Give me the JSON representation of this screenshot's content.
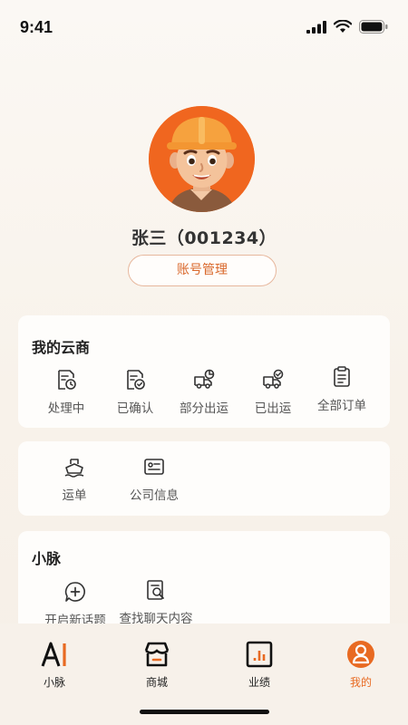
{
  "status_bar": {
    "time": "9:41"
  },
  "profile": {
    "name": "张三（001234）",
    "account_button": "账号管理"
  },
  "yunshang": {
    "title": "我的云商",
    "items": [
      {
        "label": "处理中",
        "icon": "doc-clock-icon"
      },
      {
        "label": "已确认",
        "icon": "doc-check-icon"
      },
      {
        "label": "部分出运",
        "icon": "truck-partial-icon"
      },
      {
        "label": "已出运",
        "icon": "truck-check-icon"
      },
      {
        "label": "全部订单",
        "icon": "clipboard-list-icon"
      }
    ]
  },
  "links": {
    "items": [
      {
        "label": "运单",
        "icon": "ship-icon"
      },
      {
        "label": "公司信息",
        "icon": "id-card-icon"
      }
    ]
  },
  "xiaomai": {
    "title": "小脉",
    "items": [
      {
        "label": "开启新话题",
        "icon": "chat-plus-icon"
      },
      {
        "label": "查找聊天内容",
        "icon": "doc-search-icon"
      }
    ]
  },
  "tabbar": {
    "tabs": [
      {
        "label": "小脉",
        "icon": "ai-icon",
        "active": false
      },
      {
        "label": "商城",
        "icon": "store-icon",
        "active": false
      },
      {
        "label": "业绩",
        "icon": "bar-chart-icon",
        "active": false
      },
      {
        "label": "我的",
        "icon": "user-icon",
        "active": true
      }
    ]
  },
  "colors": {
    "accent": "#e86a22",
    "avatar_bg": "#f0661f"
  }
}
